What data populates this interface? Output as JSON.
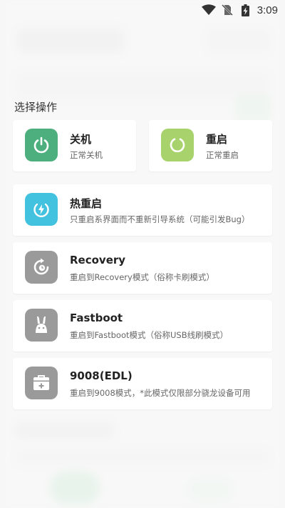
{
  "status_bar": {
    "time": "3:09",
    "icons": [
      "wifi-icon",
      "no-sim-icon",
      "battery-charging-icon"
    ]
  },
  "section_title": "选择操作",
  "actions": {
    "shutdown": {
      "title": "关机",
      "subtitle": "正常关机",
      "icon": "power-icon",
      "color": "#4caf7d"
    },
    "reboot": {
      "title": "重启",
      "subtitle": "正常重启",
      "icon": "restart-icon",
      "color": "#a8d36c"
    },
    "hot_reboot": {
      "title": "热重启",
      "subtitle": "只重启系界面而不重新引导系统（可能引发Bug）",
      "icon": "hot-reboot-icon",
      "color": "#43c2e0"
    },
    "recovery": {
      "title": "Recovery",
      "subtitle": "重启到Recovery模式（俗称卡刷模式）",
      "icon": "recovery-icon",
      "color": "#9a9a9a"
    },
    "fastboot": {
      "title": "Fastboot",
      "subtitle": "重启到Fastboot模式（俗称USB线刷模式）",
      "icon": "fastboot-bunny-icon",
      "color": "#9a9a9a"
    },
    "edl": {
      "title": "9008(EDL)",
      "subtitle": "重启到9008模式，*此模式仅限部分骁龙设备可用",
      "icon": "first-aid-kit-icon",
      "color": "#9a9a9a"
    }
  }
}
